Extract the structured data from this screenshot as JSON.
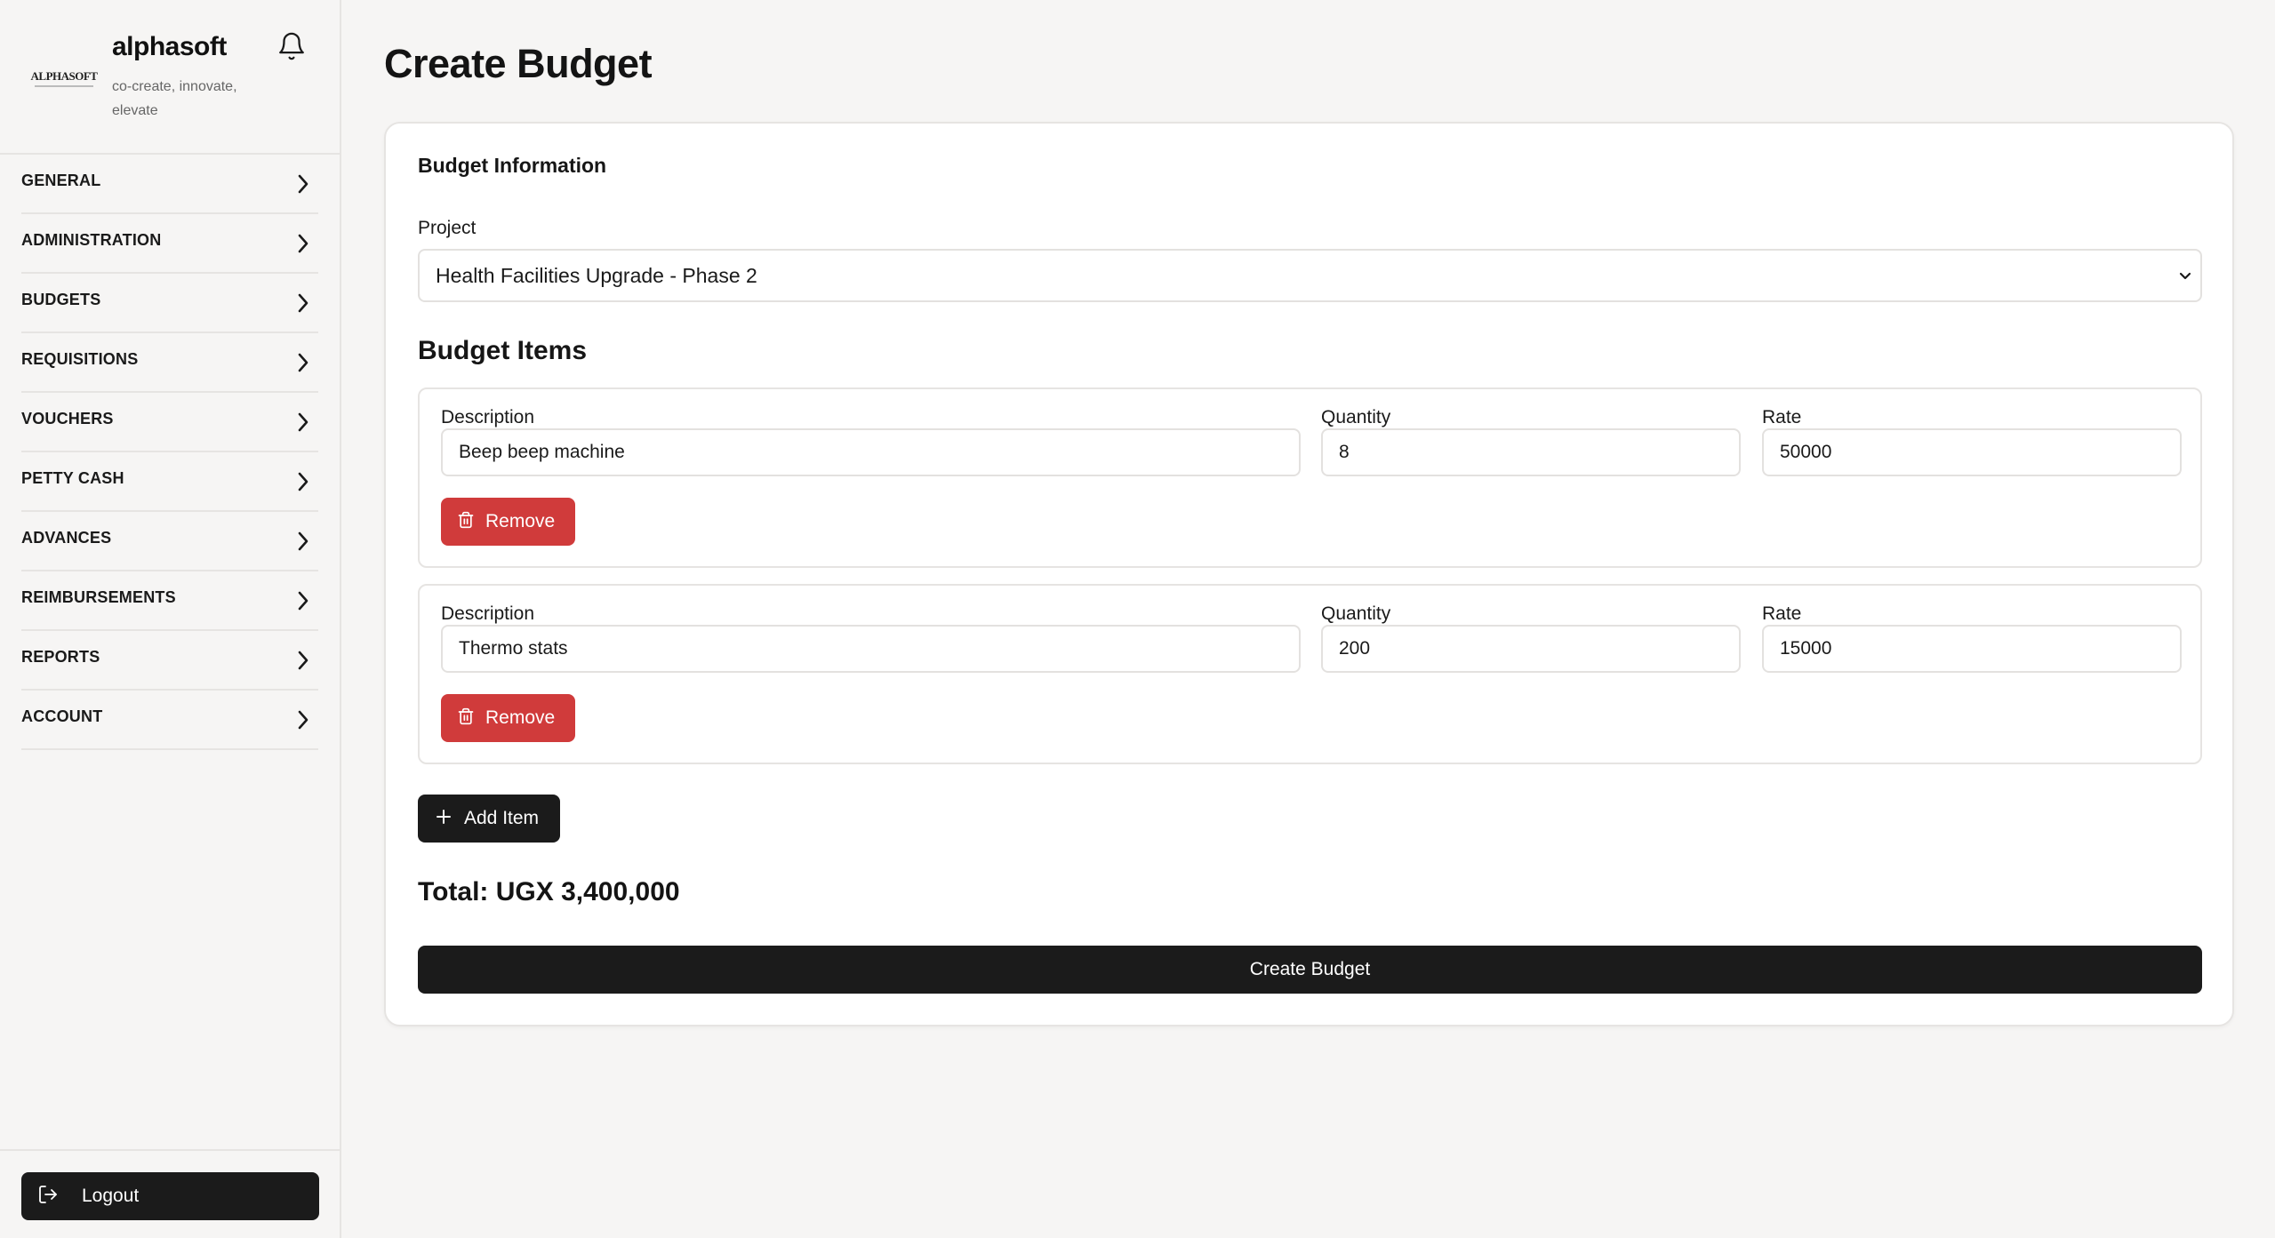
{
  "brand": {
    "logo_text": "ALPHASOFT",
    "name": "alphasoft",
    "tagline": "co-create, innovate, elevate"
  },
  "sidebar": {
    "items": [
      {
        "label": "GENERAL"
      },
      {
        "label": "ADMINISTRATION"
      },
      {
        "label": "BUDGETS"
      },
      {
        "label": "REQUISITIONS"
      },
      {
        "label": "VOUCHERS"
      },
      {
        "label": "PETTY CASH"
      },
      {
        "label": "ADVANCES"
      },
      {
        "label": "REIMBURSEMENTS"
      },
      {
        "label": "REPORTS"
      },
      {
        "label": "ACCOUNT"
      }
    ],
    "logout_label": "Logout"
  },
  "page": {
    "title": "Create Budget"
  },
  "form": {
    "section_title": "Budget Information",
    "project_label": "Project",
    "project_value": "Health Facilities Upgrade - Phase 2",
    "items_title": "Budget Items",
    "description_label": "Description",
    "quantity_label": "Quantity",
    "rate_label": "Rate",
    "remove_label": "Remove",
    "items": [
      {
        "description": "Beep beep machine",
        "quantity": "8",
        "rate": "50000"
      },
      {
        "description": "Thermo stats",
        "quantity": "200",
        "rate": "15000"
      }
    ],
    "add_item_label": "Add Item",
    "total_text": "Total: UGX 3,400,000",
    "submit_label": "Create Budget"
  },
  "colors": {
    "danger": "#d03b3b",
    "primary": "#1b1b1b",
    "background": "#f6f5f4"
  }
}
